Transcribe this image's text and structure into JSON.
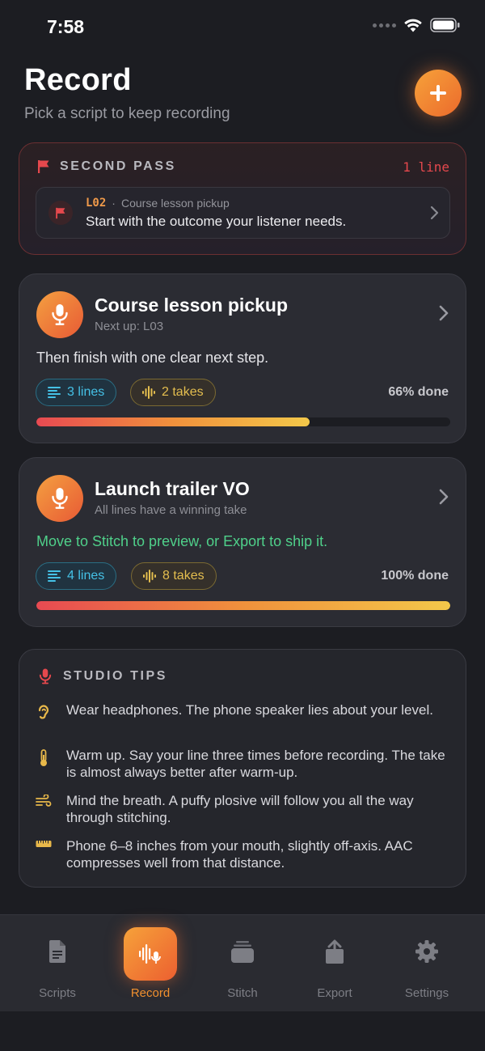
{
  "status": {
    "time": "7:58"
  },
  "header": {
    "title": "Record",
    "subtitle": "Pick a script to keep recording"
  },
  "second_pass": {
    "title": "SECOND PASS",
    "count": "1 line",
    "item": {
      "line_id": "L02",
      "separator": "·",
      "script": "Course lesson pickup",
      "text": "Start with the outcome your listener needs."
    }
  },
  "scripts": [
    {
      "title": "Course lesson pickup",
      "subtitle": "Next up: L03",
      "line": "Then finish with one clear next step.",
      "lines_label": "3 lines",
      "takes_label": "2 takes",
      "percent_label": "66% done",
      "progress": 0.66
    },
    {
      "title": "Launch trailer VO",
      "subtitle": "All lines have a winning take",
      "line": "Move to Stitch to preview, or Export to ship it.",
      "lines_label": "4 lines",
      "takes_label": "8 takes",
      "percent_label": "100% done",
      "progress": 1.0
    }
  ],
  "tips": {
    "title": "STUDIO TIPS",
    "items": [
      {
        "icon": "ear-icon",
        "text": "Wear headphones. The phone speaker lies about your level."
      },
      {
        "icon": "thermometer-icon",
        "text": "Warm up. Say your line three times before recording. The take is almost always better after warm-up."
      },
      {
        "icon": "wind-icon",
        "text": "Mind the breath. A puffy plosive will follow you all the way through stitching."
      },
      {
        "icon": "ruler-icon",
        "text": "Phone 6–8 inches from your mouth, slightly off-axis. AAC compresses well from that distance."
      }
    ]
  },
  "tabs": [
    {
      "label": "Scripts",
      "icon": "document-icon"
    },
    {
      "label": "Record",
      "icon": "waveform-mic-icon",
      "active": true
    },
    {
      "label": "Stitch",
      "icon": "stack-icon"
    },
    {
      "label": "Export",
      "icon": "share-icon"
    },
    {
      "label": "Settings",
      "icon": "gear-icon"
    }
  ],
  "colors": {
    "background": "#1c1d22",
    "accent": "#f0902f",
    "danger": "#e5484d",
    "success": "#4fd08a",
    "lines": "#45c1e6",
    "takes": "#e4be4f"
  }
}
